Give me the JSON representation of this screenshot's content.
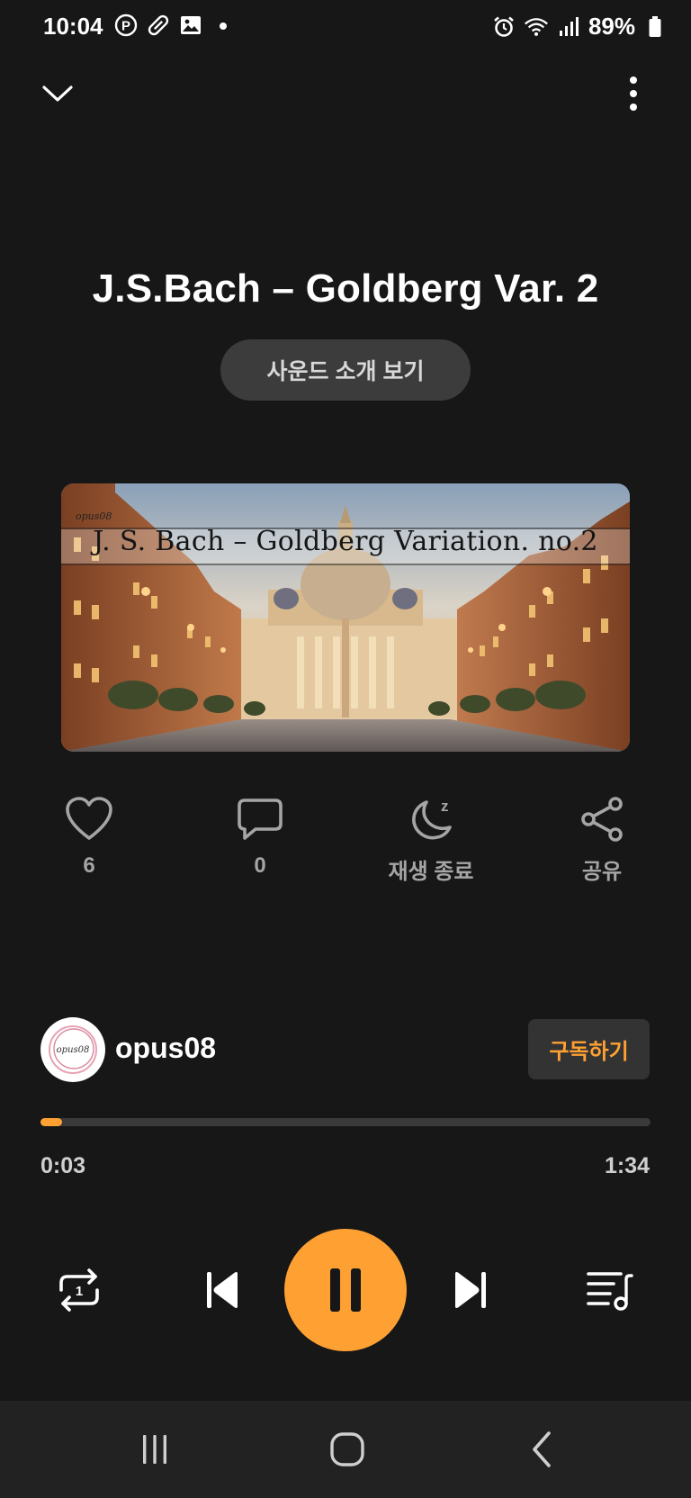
{
  "status_bar": {
    "time": "10:04",
    "battery_percent": "89%",
    "left_icons": [
      "parking-icon",
      "pill-icon",
      "gallery-icon",
      "dot-icon"
    ],
    "right_icons": [
      "alarm-icon",
      "wifi-icon",
      "signal-icon",
      "battery-icon"
    ]
  },
  "player": {
    "title": "J.S.Bach – Goldberg Var. 2",
    "intro_button": "사운드 소개 보기",
    "artwork": {
      "caption": "J. S. Bach – Goldberg Variation. no.2",
      "tag": "opus08"
    },
    "actions": {
      "like_count": "6",
      "comment_count": "0",
      "sleep_timer_label": "재생 종료",
      "share_label": "공유"
    },
    "channel": {
      "name": "opus08",
      "avatar_text": "opus08",
      "subscribe_label": "구독하기"
    },
    "progress": {
      "current": "0:03",
      "total": "1:34",
      "fraction": 0.035
    }
  },
  "colors": {
    "background": "#171717",
    "accent": "#ffa033",
    "button_bg": "#3c3c3c",
    "muted_text": "#a5a5a5",
    "nav_bar": "#222222"
  }
}
